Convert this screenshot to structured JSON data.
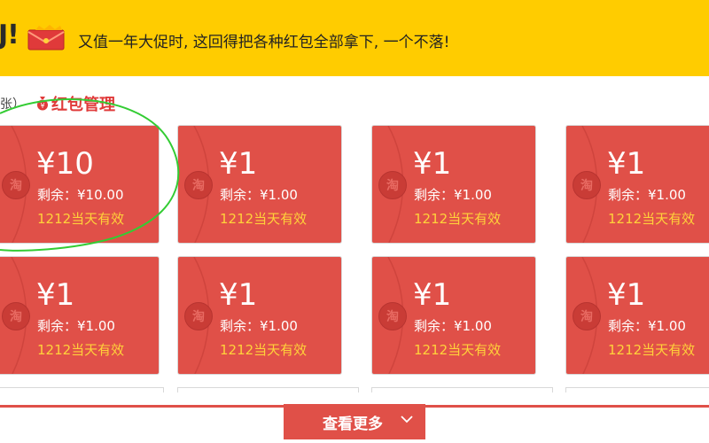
{
  "banner": {
    "logo_fragment": "J!",
    "text": "又值一年大促时, 这回得把各种红包全部拿下, 一个不落!"
  },
  "section": {
    "prefix": "张）",
    "title": "红包管理"
  },
  "packets": [
    {
      "amount": "¥10",
      "remain": "剩余：¥10.00",
      "valid": "1212当天有效",
      "seal": "淘"
    },
    {
      "amount": "¥1",
      "remain": "剩余：¥1.00",
      "valid": "1212当天有效",
      "seal": "淘"
    },
    {
      "amount": "¥1",
      "remain": "剩余：¥1.00",
      "valid": "1212当天有效",
      "seal": "淘"
    },
    {
      "amount": "¥1",
      "remain": "剩余：¥1.00",
      "valid": "1212当天有效",
      "seal": "淘"
    },
    {
      "amount": "¥1",
      "remain": "剩余：¥1.00",
      "valid": "1212当天有效",
      "seal": "淘"
    },
    {
      "amount": "¥1",
      "remain": "剩余：¥1.00",
      "valid": "1212当天有效",
      "seal": "淘"
    },
    {
      "amount": "¥1",
      "remain": "剩余：¥1.00",
      "valid": "1212当天有效",
      "seal": "淘"
    },
    {
      "amount": "¥1",
      "remain": "剩余：¥1.00",
      "valid": "1212当天有效",
      "seal": "淘"
    }
  ],
  "more_button": {
    "label": "查看更多",
    "icon": "chevron-down-icon"
  },
  "colors": {
    "banner": "#ffcc00",
    "packet": "#e05048",
    "valid_text": "#ffd23a",
    "title": "#e03a3a",
    "annotation": "#33cc33"
  }
}
